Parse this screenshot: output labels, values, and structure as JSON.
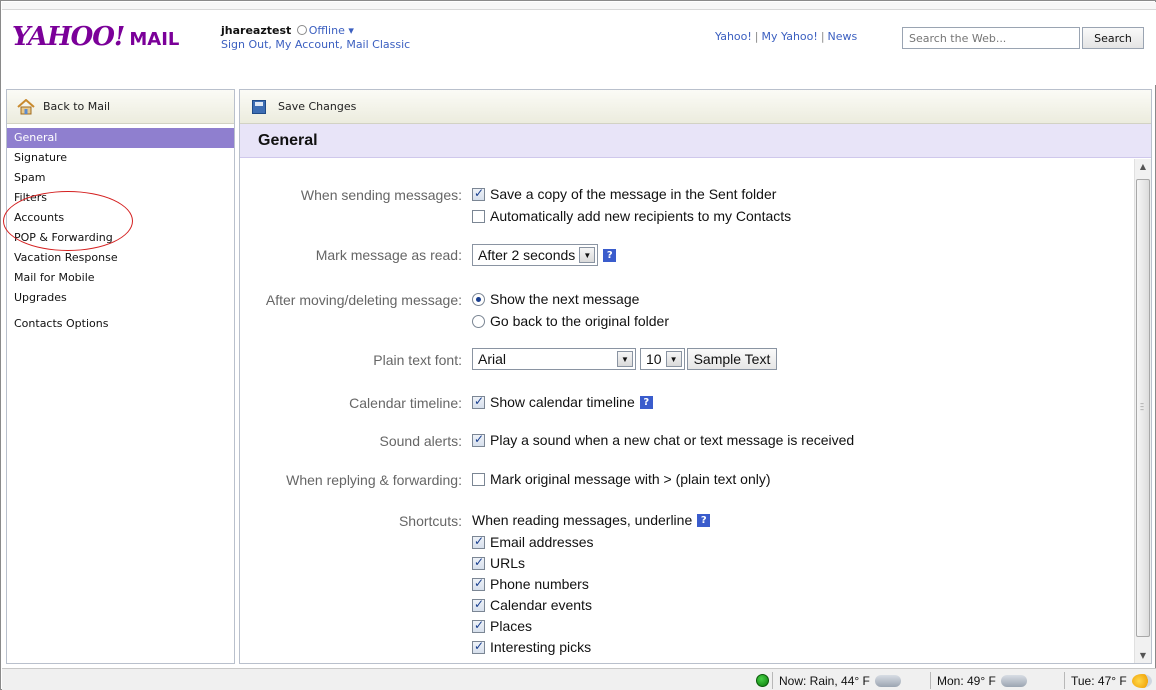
{
  "header": {
    "logo_text": "YAHOO!",
    "logo_suffix": "MAIL",
    "username": "jhareaztest",
    "status": "Offline ▾",
    "account_links": "Sign Out, My Account, Mail Classic",
    "top_links": [
      "Yahoo!",
      "My Yahoo!",
      "News"
    ],
    "search_placeholder": "Search the Web...",
    "search_button": "Search"
  },
  "sidebar": {
    "back_label": "Back to Mail",
    "items": [
      {
        "label": "General",
        "active": true
      },
      {
        "label": "Signature"
      },
      {
        "label": "Spam"
      },
      {
        "label": "Filters"
      },
      {
        "label": "Accounts"
      },
      {
        "label": "POP & Forwarding"
      },
      {
        "label": "Vacation Response"
      },
      {
        "label": "Mail for Mobile"
      },
      {
        "label": "Upgrades"
      },
      {
        "label": "Contacts Options"
      }
    ]
  },
  "toolbar": {
    "save_label": "Save Changes"
  },
  "main": {
    "title": "General",
    "sending": {
      "label": "When sending messages:",
      "opt1": "Save a copy of the message in the Sent folder",
      "opt1_checked": true,
      "opt2": "Automatically add new recipients to my Contacts",
      "opt2_checked": false
    },
    "mark_read": {
      "label": "Mark message as read:",
      "value": "After 2 seconds"
    },
    "after_moving": {
      "label": "After moving/deleting message:",
      "opt1": "Show the next message",
      "opt2": "Go back to the original folder",
      "selected": "opt1"
    },
    "plain_font": {
      "label": "Plain text font:",
      "font": "Arial",
      "size": "10",
      "sample_button": "Sample Text"
    },
    "calendar": {
      "label": "Calendar timeline:",
      "opt": "Show calendar timeline",
      "checked": true
    },
    "sound": {
      "label": "Sound alerts:",
      "opt": "Play a sound when a new chat or text message is received",
      "checked": true
    },
    "replying": {
      "label": "When replying & forwarding:",
      "opt": "Mark original message with > (plain text only)",
      "checked": false
    },
    "shortcuts": {
      "label": "Shortcuts:",
      "intro": "When reading messages, underline",
      "items": [
        "Email addresses",
        "URLs",
        "Phone numbers",
        "Calendar events",
        "Places",
        "Interesting picks"
      ]
    }
  },
  "statusbar": {
    "now": "Now: Rain, 44° F",
    "mon": "Mon: 49° F",
    "tue": "Tue: 47° F"
  },
  "colors": {
    "brand": "#7b0099",
    "active_nav": "#8f7fcf",
    "section_bg": "#e8e4f8"
  }
}
